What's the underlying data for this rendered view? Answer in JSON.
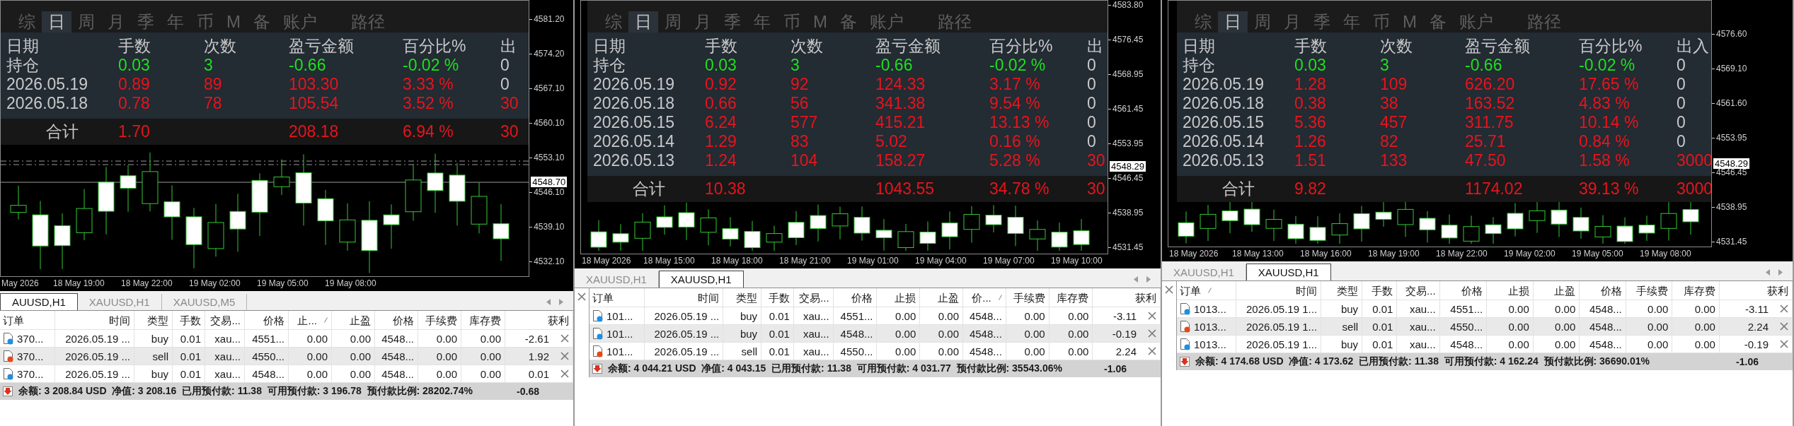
{
  "panels": [
    {
      "chart": {
        "overlay": {
          "tabs": [
            {
              "label": "综",
              "selected": false
            },
            {
              "label": "日",
              "selected": true
            },
            {
              "label": "周",
              "selected": false
            },
            {
              "label": "月",
              "selected": false
            },
            {
              "label": "季",
              "selected": false
            },
            {
              "label": "年",
              "selected": false
            },
            {
              "label": "币",
              "selected": false
            },
            {
              "label": "M",
              "selected": false
            },
            {
              "label": "备",
              "selected": false
            },
            {
              "label": "账户",
              "selected": false
            },
            {
              "label": "路径",
              "selected": false
            }
          ],
          "columns": [
            "日期",
            "手数",
            "次数",
            "盈亏金额",
            "百分比%",
            "出"
          ],
          "rows": [
            {
              "kind": "open",
              "flow_highlight": false,
              "cells": [
                "持仓",
                "0.03",
                "3",
                "-0.66",
                "-0.02 %",
                "0"
              ]
            },
            {
              "kind": "day",
              "flow_highlight": false,
              "cells": [
                "2026.05.19",
                "0.89",
                "89",
                "103.30",
                "3.33 %",
                "0"
              ]
            },
            {
              "kind": "day",
              "flow_highlight": true,
              "cells": [
                "2026.05.18",
                "0.78",
                "78",
                "105.54",
                "3.52 %",
                "30"
              ]
            }
          ],
          "total": {
            "label": "合计",
            "lots": "1.70",
            "amount": "208.18",
            "percent": "6.94 %",
            "flow": "30"
          }
        },
        "price_ticks": [
          "4581.20",
          "4574.20",
          "4567.10",
          "4560.10",
          "4553.10",
          "4546.10",
          "4539.10",
          "4532.10"
        ],
        "current_price": "4548.70",
        "time_ticks": [
          "May 2026",
          "18 May 19:00",
          "18 May 22:00",
          "19 May 02:00",
          "19 May 05:00",
          "19 May 08:00"
        ]
      },
      "terminal": {
        "closable": false,
        "tabs": [
          {
            "label": "AUUSD,H1",
            "selected": true
          },
          {
            "label": "XAUUSD,H1",
            "selected": false
          },
          {
            "label": "XAUUSD,M5",
            "selected": false
          }
        ],
        "columns": [
          {
            "label": "订单",
            "sorted": false
          },
          {
            "label": "时间",
            "sorted": false
          },
          {
            "label": "类型",
            "sorted": false
          },
          {
            "label": "手数",
            "sorted": false
          },
          {
            "label": "交易...",
            "sorted": false
          },
          {
            "label": "价格",
            "sorted": false
          },
          {
            "label": "止...",
            "sorted": true
          },
          {
            "label": "止盈",
            "sorted": false
          },
          {
            "label": "价格",
            "sorted": false
          },
          {
            "label": "手续费",
            "sorted": false
          },
          {
            "label": "库存费",
            "sorted": false
          },
          {
            "label": "获利",
            "sorted": false
          }
        ],
        "rows": [
          {
            "kind": "buy",
            "selected": false,
            "cells": [
              "370...",
              "2026.05.19 ...",
              "buy",
              "0.01",
              "xau...",
              "4551...",
              "0.00",
              "0.00",
              "4548...",
              "0.00",
              "0.00",
              "-2.61"
            ]
          },
          {
            "kind": "sell",
            "selected": true,
            "cells": [
              "370...",
              "2026.05.19 ...",
              "sell",
              "0.01",
              "xau...",
              "4550...",
              "0.00",
              "0.00",
              "4548...",
              "0.00",
              "0.00",
              "1.92"
            ]
          },
          {
            "kind": "buy",
            "selected": false,
            "cells": [
              "370...",
              "2026.05.19 ...",
              "buy",
              "0.01",
              "xau...",
              "4548...",
              "0.00",
              "0.00",
              "4548...",
              "0.00",
              "0.00",
              "0.01"
            ]
          }
        ],
        "status": "余额: 3 208.84 USD  净值: 3 208.16  已用预付款: 11.38  可用预付款: 3 196.78  预付款比例: 28202.74%",
        "profit": "-0.68"
      }
    },
    {
      "chart": {
        "overlay": {
          "tabs": [
            {
              "label": "综",
              "selected": false
            },
            {
              "label": "日",
              "selected": true
            },
            {
              "label": "周",
              "selected": false
            },
            {
              "label": "月",
              "selected": false
            },
            {
              "label": "季",
              "selected": false
            },
            {
              "label": "年",
              "selected": false
            },
            {
              "label": "币",
              "selected": false
            },
            {
              "label": "M",
              "selected": false
            },
            {
              "label": "备",
              "selected": false
            },
            {
              "label": "账户",
              "selected": false
            },
            {
              "label": "路径",
              "selected": false
            }
          ],
          "columns": [
            "日期",
            "手数",
            "次数",
            "盈亏金额",
            "百分比%",
            "出"
          ],
          "rows": [
            {
              "kind": "open",
              "flow_highlight": false,
              "cells": [
                "持仓",
                "0.03",
                "3",
                "-0.66",
                "-0.02 %",
                "0"
              ]
            },
            {
              "kind": "day",
              "flow_highlight": false,
              "cells": [
                "2026.05.19",
                "0.92",
                "92",
                "124.33",
                "3.17 %",
                "0"
              ]
            },
            {
              "kind": "day",
              "flow_highlight": false,
              "cells": [
                "2026.05.18",
                "0.66",
                "56",
                "341.38",
                "9.54 %",
                "0"
              ]
            },
            {
              "kind": "day",
              "flow_highlight": false,
              "cells": [
                "2026.05.15",
                "6.24",
                "577",
                "415.21",
                "13.13 %",
                "0"
              ]
            },
            {
              "kind": "day",
              "flow_highlight": false,
              "cells": [
                "2026.05.14",
                "1.29",
                "83",
                "5.02",
                "0.16 %",
                "0"
              ]
            },
            {
              "kind": "day",
              "flow_highlight": true,
              "cells": [
                "2026.05.13",
                "1.24",
                "104",
                "158.27",
                "5.28 %",
                "30"
              ]
            }
          ],
          "total": {
            "label": "合计",
            "lots": "10.38",
            "amount": "1043.55",
            "percent": "34.78 %",
            "flow": "30"
          }
        },
        "price_ticks": [
          "4583.80",
          "4576.45",
          "4568.95",
          "4561.45",
          "4553.95",
          "4546.45",
          "4538.95",
          "4531.45"
        ],
        "current_price": "4548.29",
        "time_ticks": [
          "18 May 2026",
          "18 May 15:00",
          "18 May 18:00",
          "18 May 21:00",
          "19 May 01:00",
          "19 May 04:00",
          "19 May 07:00",
          "19 May 10:00"
        ]
      },
      "terminal": {
        "closable": true,
        "tabs": [
          {
            "label": "XAUUSD,H1",
            "selected": false
          },
          {
            "label": "XAUUSD,H1",
            "selected": true
          }
        ],
        "columns": [
          {
            "label": "订单",
            "sorted": false
          },
          {
            "label": "时间",
            "sorted": false
          },
          {
            "label": "类型",
            "sorted": false
          },
          {
            "label": "手数",
            "sorted": false
          },
          {
            "label": "交易...",
            "sorted": false
          },
          {
            "label": "价格",
            "sorted": false
          },
          {
            "label": "止损",
            "sorted": false
          },
          {
            "label": "止盈",
            "sorted": false
          },
          {
            "label": "价...",
            "sorted": true
          },
          {
            "label": "手续费",
            "sorted": false
          },
          {
            "label": "库存费",
            "sorted": false
          },
          {
            "label": "获利",
            "sorted": false
          }
        ],
        "rows": [
          {
            "kind": "buy",
            "selected": false,
            "cells": [
              "101...",
              "2026.05.19 ...",
              "buy",
              "0.01",
              "xau...",
              "4551...",
              "0.00",
              "0.00",
              "4548...",
              "0.00",
              "0.00",
              "-3.11"
            ]
          },
          {
            "kind": "buy",
            "selected": true,
            "cells": [
              "101...",
              "2026.05.19 ...",
              "buy",
              "0.01",
              "xau...",
              "4548...",
              "0.00",
              "0.00",
              "4548...",
              "0.00",
              "0.00",
              "-0.19"
            ]
          },
          {
            "kind": "sell",
            "selected": false,
            "cells": [
              "101...",
              "2026.05.19 ...",
              "sell",
              "0.01",
              "xau...",
              "4550...",
              "0.00",
              "0.00",
              "4548...",
              "0.00",
              "0.00",
              "2.24"
            ]
          }
        ],
        "status": "余额: 4 044.21 USD  净值: 4 043.15  已用预付款: 11.38  可用预付款: 4 031.77  预付款比例: 35543.06%",
        "profit": "-1.06"
      }
    },
    {
      "chart": {
        "overlay": {
          "tabs": [
            {
              "label": "综",
              "selected": false
            },
            {
              "label": "日",
              "selected": true
            },
            {
              "label": "周",
              "selected": false
            },
            {
              "label": "月",
              "selected": false
            },
            {
              "label": "季",
              "selected": false
            },
            {
              "label": "年",
              "selected": false
            },
            {
              "label": "币",
              "selected": false
            },
            {
              "label": "M",
              "selected": false
            },
            {
              "label": "备",
              "selected": false
            },
            {
              "label": "账户",
              "selected": false
            },
            {
              "label": "路径",
              "selected": false
            }
          ],
          "columns": [
            "日期",
            "手数",
            "次数",
            "盈亏金额",
            "百分比%",
            "出入"
          ],
          "rows": [
            {
              "kind": "open",
              "flow_highlight": false,
              "cells": [
                "持仓",
                "0.03",
                "3",
                "-0.66",
                "-0.02 %",
                "0"
              ]
            },
            {
              "kind": "day",
              "flow_highlight": false,
              "cells": [
                "2026.05.19",
                "1.28",
                "109",
                "626.20",
                "17.65 %",
                "0"
              ]
            },
            {
              "kind": "day",
              "flow_highlight": false,
              "cells": [
                "2026.05.18",
                "0.38",
                "38",
                "163.52",
                "4.83 %",
                "0"
              ]
            },
            {
              "kind": "day",
              "flow_highlight": false,
              "cells": [
                "2026.05.15",
                "5.36",
                "457",
                "311.75",
                "10.14 %",
                "0"
              ]
            },
            {
              "kind": "day",
              "flow_highlight": false,
              "cells": [
                "2026.05.14",
                "1.26",
                "82",
                "25.71",
                "0.84 %",
                "0"
              ]
            },
            {
              "kind": "day",
              "flow_highlight": true,
              "cells": [
                "2026.05.13",
                "1.51",
                "133",
                "47.50",
                "1.58 %",
                "3000"
              ]
            }
          ],
          "total": {
            "label": "合计",
            "lots": "9.82",
            "amount": "1174.02",
            "percent": "39.13 %",
            "flow": "3000"
          }
        },
        "price_ticks": [
          "4576.60",
          "4569.10",
          "4561.60",
          "4553.95",
          "4546.45",
          "4538.95",
          "4531.45"
        ],
        "current_price": "4548.29",
        "time_ticks": [
          "18 May 2026",
          "18 May 13:00",
          "18 May 16:00",
          "18 May 19:00",
          "18 May 22:00",
          "19 May 02:00",
          "19 May 05:00",
          "19 May 08:00"
        ]
      },
      "terminal": {
        "closable": true,
        "tabs": [
          {
            "label": "XAUUSD,H1",
            "selected": false
          },
          {
            "label": "XAUUSD,H1",
            "selected": true
          }
        ],
        "columns": [
          {
            "label": "订单",
            "sorted": true
          },
          {
            "label": "时间",
            "sorted": false
          },
          {
            "label": "类型",
            "sorted": false
          },
          {
            "label": "手数",
            "sorted": false
          },
          {
            "label": "交易...",
            "sorted": false
          },
          {
            "label": "价格",
            "sorted": false
          },
          {
            "label": "止损",
            "sorted": false
          },
          {
            "label": "止盈",
            "sorted": false
          },
          {
            "label": "价格",
            "sorted": false
          },
          {
            "label": "手续费",
            "sorted": false
          },
          {
            "label": "库存费",
            "sorted": false
          },
          {
            "label": "获利",
            "sorted": false
          }
        ],
        "rows": [
          {
            "kind": "buy",
            "selected": false,
            "cells": [
              "1013...",
              "2026.05.19 1...",
              "buy",
              "0.01",
              "xau...",
              "4551...",
              "0.00",
              "0.00",
              "4548...",
              "0.00",
              "0.00",
              "-3.11"
            ]
          },
          {
            "kind": "sell",
            "selected": true,
            "cells": [
              "1013...",
              "2026.05.19 1...",
              "sell",
              "0.01",
              "xau...",
              "4550...",
              "0.00",
              "0.00",
              "4548...",
              "0.00",
              "0.00",
              "2.24"
            ]
          },
          {
            "kind": "buy",
            "selected": false,
            "cells": [
              "1013...",
              "2026.05.19 1...",
              "buy",
              "0.01",
              "xau...",
              "4548...",
              "0.00",
              "0.00",
              "4548...",
              "0.00",
              "0.00",
              "-0.19"
            ]
          }
        ],
        "status": "余额: 4 174.68 USD  净值: 4 173.62  已用预付款: 11.38  可用预付款: 4 162.24  预付款比例: 36690.01%",
        "profit": "-1.06"
      }
    }
  ]
}
